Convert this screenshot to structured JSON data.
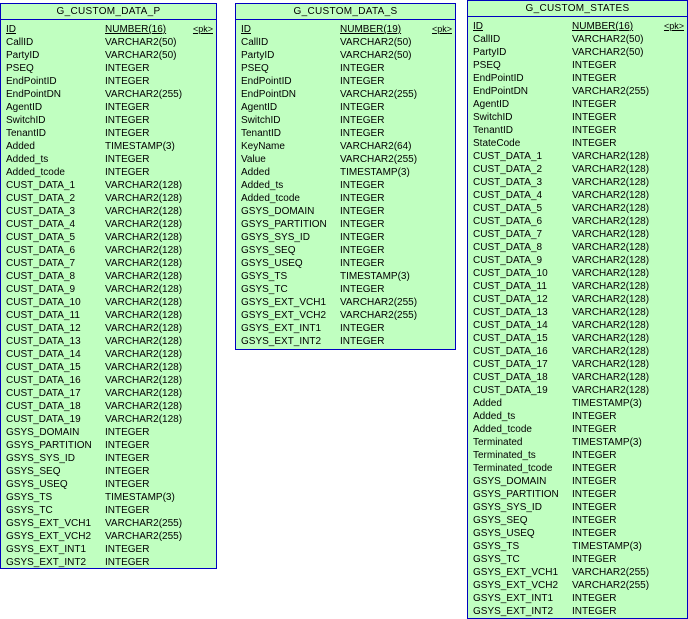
{
  "tables": [
    {
      "name": "G_CUSTOM_DATA_P",
      "columns": [
        {
          "name": "ID",
          "type": "NUMBER(16)",
          "key": "<pk>"
        },
        {
          "name": "CallID",
          "type": "VARCHAR2(50)"
        },
        {
          "name": "PartyID",
          "type": "VARCHAR2(50)"
        },
        {
          "name": "PSEQ",
          "type": "INTEGER"
        },
        {
          "name": "EndPointID",
          "type": "INTEGER"
        },
        {
          "name": "EndPointDN",
          "type": "VARCHAR2(255)"
        },
        {
          "name": "AgentID",
          "type": "INTEGER"
        },
        {
          "name": "SwitchID",
          "type": "INTEGER"
        },
        {
          "name": "TenantID",
          "type": "INTEGER"
        },
        {
          "name": "Added",
          "type": "TIMESTAMP(3)"
        },
        {
          "name": "Added_ts",
          "type": "INTEGER"
        },
        {
          "name": "Added_tcode",
          "type": "INTEGER"
        },
        {
          "name": "CUST_DATA_1",
          "type": "VARCHAR2(128)"
        },
        {
          "name": "CUST_DATA_2",
          "type": "VARCHAR2(128)"
        },
        {
          "name": "CUST_DATA_3",
          "type": "VARCHAR2(128)"
        },
        {
          "name": "CUST_DATA_4",
          "type": "VARCHAR2(128)"
        },
        {
          "name": "CUST_DATA_5",
          "type": "VARCHAR2(128)"
        },
        {
          "name": "CUST_DATA_6",
          "type": "VARCHAR2(128)"
        },
        {
          "name": "CUST_DATA_7",
          "type": "VARCHAR2(128)"
        },
        {
          "name": "CUST_DATA_8",
          "type": "VARCHAR2(128)"
        },
        {
          "name": "CUST_DATA_9",
          "type": "VARCHAR2(128)"
        },
        {
          "name": "CUST_DATA_10",
          "type": "VARCHAR2(128)"
        },
        {
          "name": "CUST_DATA_11",
          "type": "VARCHAR2(128)"
        },
        {
          "name": "CUST_DATA_12",
          "type": "VARCHAR2(128)"
        },
        {
          "name": "CUST_DATA_13",
          "type": "VARCHAR2(128)"
        },
        {
          "name": "CUST_DATA_14",
          "type": "VARCHAR2(128)"
        },
        {
          "name": "CUST_DATA_15",
          "type": "VARCHAR2(128)"
        },
        {
          "name": "CUST_DATA_16",
          "type": "VARCHAR2(128)"
        },
        {
          "name": "CUST_DATA_17",
          "type": "VARCHAR2(128)"
        },
        {
          "name": "CUST_DATA_18",
          "type": "VARCHAR2(128)"
        },
        {
          "name": "CUST_DATA_19",
          "type": "VARCHAR2(128)"
        },
        {
          "name": "GSYS_DOMAIN",
          "type": "INTEGER"
        },
        {
          "name": "GSYS_PARTITION",
          "type": "INTEGER"
        },
        {
          "name": "GSYS_SYS_ID",
          "type": "INTEGER"
        },
        {
          "name": "GSYS_SEQ",
          "type": "INTEGER"
        },
        {
          "name": "GSYS_USEQ",
          "type": "INTEGER"
        },
        {
          "name": "GSYS_TS",
          "type": "TIMESTAMP(3)"
        },
        {
          "name": "GSYS_TC",
          "type": "INTEGER"
        },
        {
          "name": "GSYS_EXT_VCH1",
          "type": "VARCHAR2(255)"
        },
        {
          "name": "GSYS_EXT_VCH2",
          "type": "VARCHAR2(255)"
        },
        {
          "name": "GSYS_EXT_INT1",
          "type": "INTEGER"
        },
        {
          "name": "GSYS_EXT_INT2",
          "type": "INTEGER"
        }
      ]
    },
    {
      "name": "G_CUSTOM_DATA_S",
      "columns": [
        {
          "name": "ID",
          "type": "NUMBER(19)",
          "key": "<pk>"
        },
        {
          "name": "CallID",
          "type": "VARCHAR2(50)"
        },
        {
          "name": "PartyID",
          "type": "VARCHAR2(50)"
        },
        {
          "name": "PSEQ",
          "type": "INTEGER"
        },
        {
          "name": "EndPointID",
          "type": "INTEGER"
        },
        {
          "name": "EndPointDN",
          "type": "VARCHAR2(255)"
        },
        {
          "name": "AgentID",
          "type": "INTEGER"
        },
        {
          "name": "SwitchID",
          "type": "INTEGER"
        },
        {
          "name": "TenantID",
          "type": "INTEGER"
        },
        {
          "name": "KeyName",
          "type": "VARCHAR2(64)"
        },
        {
          "name": "Value",
          "type": "VARCHAR2(255)"
        },
        {
          "name": "Added",
          "type": "TIMESTAMP(3)"
        },
        {
          "name": "Added_ts",
          "type": "INTEGER"
        },
        {
          "name": "Added_tcode",
          "type": "INTEGER"
        },
        {
          "name": "GSYS_DOMAIN",
          "type": "INTEGER"
        },
        {
          "name": "GSYS_PARTITION",
          "type": "INTEGER"
        },
        {
          "name": "GSYS_SYS_ID",
          "type": "INTEGER"
        },
        {
          "name": "GSYS_SEQ",
          "type": "INTEGER"
        },
        {
          "name": "GSYS_USEQ",
          "type": "INTEGER"
        },
        {
          "name": "GSYS_TS",
          "type": "TIMESTAMP(3)"
        },
        {
          "name": "GSYS_TC",
          "type": "INTEGER"
        },
        {
          "name": "GSYS_EXT_VCH1",
          "type": "VARCHAR2(255)"
        },
        {
          "name": "GSYS_EXT_VCH2",
          "type": "VARCHAR2(255)"
        },
        {
          "name": "GSYS_EXT_INT1",
          "type": "INTEGER"
        },
        {
          "name": "GSYS_EXT_INT2",
          "type": "INTEGER"
        }
      ]
    },
    {
      "name": "G_CUSTOM_STATES",
      "columns": [
        {
          "name": "ID",
          "type": "NUMBER(16)",
          "key": "<pk>"
        },
        {
          "name": "CallID",
          "type": "VARCHAR2(50)"
        },
        {
          "name": "PartyID",
          "type": "VARCHAR2(50)"
        },
        {
          "name": "PSEQ",
          "type": "INTEGER"
        },
        {
          "name": "EndPointID",
          "type": "INTEGER"
        },
        {
          "name": "EndPointDN",
          "type": "VARCHAR2(255)"
        },
        {
          "name": "AgentID",
          "type": "INTEGER"
        },
        {
          "name": "SwitchID",
          "type": "INTEGER"
        },
        {
          "name": "TenantID",
          "type": "INTEGER"
        },
        {
          "name": "StateCode",
          "type": "INTEGER"
        },
        {
          "name": "CUST_DATA_1",
          "type": "VARCHAR2(128)"
        },
        {
          "name": "CUST_DATA_2",
          "type": "VARCHAR2(128)"
        },
        {
          "name": "CUST_DATA_3",
          "type": "VARCHAR2(128)"
        },
        {
          "name": "CUST_DATA_4",
          "type": "VARCHAR2(128)"
        },
        {
          "name": "CUST_DATA_5",
          "type": "VARCHAR2(128)"
        },
        {
          "name": "CUST_DATA_6",
          "type": "VARCHAR2(128)"
        },
        {
          "name": "CUST_DATA_7",
          "type": "VARCHAR2(128)"
        },
        {
          "name": "CUST_DATA_8",
          "type": "VARCHAR2(128)"
        },
        {
          "name": "CUST_DATA_9",
          "type": "VARCHAR2(128)"
        },
        {
          "name": "CUST_DATA_10",
          "type": "VARCHAR2(128)"
        },
        {
          "name": "CUST_DATA_11",
          "type": "VARCHAR2(128)"
        },
        {
          "name": "CUST_DATA_12",
          "type": "VARCHAR2(128)"
        },
        {
          "name": "CUST_DATA_13",
          "type": "VARCHAR2(128)"
        },
        {
          "name": "CUST_DATA_14",
          "type": "VARCHAR2(128)"
        },
        {
          "name": "CUST_DATA_15",
          "type": "VARCHAR2(128)"
        },
        {
          "name": "CUST_DATA_16",
          "type": "VARCHAR2(128)"
        },
        {
          "name": "CUST_DATA_17",
          "type": "VARCHAR2(128)"
        },
        {
          "name": "CUST_DATA_18",
          "type": "VARCHAR2(128)"
        },
        {
          "name": "CUST_DATA_19",
          "type": "VARCHAR2(128)"
        },
        {
          "name": "Added",
          "type": "TIMESTAMP(3)"
        },
        {
          "name": "Added_ts",
          "type": "INTEGER"
        },
        {
          "name": "Added_tcode",
          "type": "INTEGER"
        },
        {
          "name": "Terminated",
          "type": "TIMESTAMP(3)"
        },
        {
          "name": "Terminated_ts",
          "type": "INTEGER"
        },
        {
          "name": "Terminated_tcode",
          "type": "INTEGER"
        },
        {
          "name": "GSYS_DOMAIN",
          "type": "INTEGER"
        },
        {
          "name": "GSYS_PARTITION",
          "type": "INTEGER"
        },
        {
          "name": "GSYS_SYS_ID",
          "type": "INTEGER"
        },
        {
          "name": "GSYS_SEQ",
          "type": "INTEGER"
        },
        {
          "name": "GSYS_USEQ",
          "type": "INTEGER"
        },
        {
          "name": "GSYS_TS",
          "type": "TIMESTAMP(3)"
        },
        {
          "name": "GSYS_TC",
          "type": "INTEGER"
        },
        {
          "name": "GSYS_EXT_VCH1",
          "type": "VARCHAR2(255)"
        },
        {
          "name": "GSYS_EXT_VCH2",
          "type": "VARCHAR2(255)"
        },
        {
          "name": "GSYS_EXT_INT1",
          "type": "INTEGER"
        },
        {
          "name": "GSYS_EXT_INT2",
          "type": "INTEGER"
        }
      ]
    }
  ],
  "colors": {
    "fill": "#c0ffc0",
    "border": "#0000c0"
  }
}
